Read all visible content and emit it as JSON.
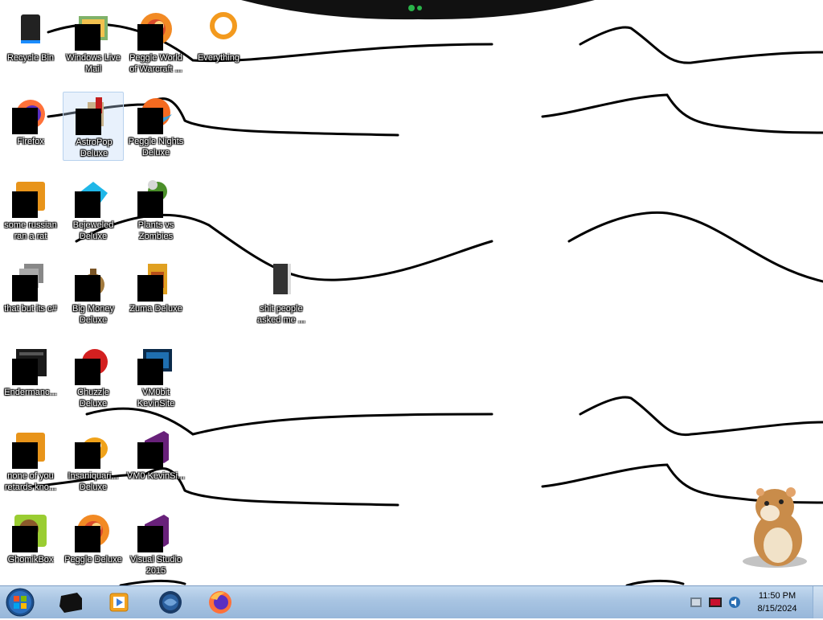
{
  "desktop": {
    "icons": [
      {
        "label": "Recycle Bin",
        "icon": "recycle-bin-icon"
      },
      {
        "label": "Windows Live Mail",
        "icon": "mail-icon"
      },
      {
        "label": "Peggle World of Warcraft ...",
        "icon": "peggle-icon"
      },
      {
        "label": "Everything",
        "icon": "search-app-icon"
      },
      {
        "label": "Firefox",
        "icon": "firefox-icon"
      },
      {
        "label": "AstroPop Deluxe",
        "icon": "astropop-icon"
      },
      {
        "label": "Peggle Nights Deluxe",
        "icon": "peggle-nights-icon"
      },
      {
        "label": "some russian ran a rat",
        "icon": "app-icon"
      },
      {
        "label": "Bejeweled Deluxe",
        "icon": "gem-icon"
      },
      {
        "label": "Plants vs Zombies",
        "icon": "plant-icon"
      },
      {
        "label": "that but its c#",
        "icon": "shortcut-icon"
      },
      {
        "label": "Big Money Deluxe",
        "icon": "money-bag-icon"
      },
      {
        "label": "Zuma Deluxe",
        "icon": "zuma-icon"
      },
      {
        "label": "shit people asked me ...",
        "icon": "folder-icon"
      },
      {
        "label": "Endermanc...",
        "icon": "terminal-icon"
      },
      {
        "label": "Chuzzle Deluxe",
        "icon": "chuzzle-icon"
      },
      {
        "label": "VM0bit KevinSite",
        "icon": "monitor-icon"
      },
      {
        "label": "none of you retards kno...",
        "icon": "app-icon"
      },
      {
        "label": "Insaniquari... Deluxe",
        "icon": "fish-icon"
      },
      {
        "label": "VM0 KevinSi...",
        "icon": "visual-studio-icon"
      },
      {
        "label": "GhomikBox",
        "icon": "box-icon"
      },
      {
        "label": "Peggle Deluxe",
        "icon": "peggle-icon"
      },
      {
        "label": "Visual Studio 2015",
        "icon": "visual-studio-icon"
      }
    ]
  },
  "taskbar": {
    "start_label": "Start",
    "pinned": [
      {
        "name": "taskbar-app-dark",
        "icon": "app-icon"
      },
      {
        "name": "taskbar-app-media",
        "icon": "media-player-icon"
      },
      {
        "name": "taskbar-app-globe",
        "icon": "globe-icon"
      },
      {
        "name": "taskbar-app-firefox",
        "icon": "firefox-icon"
      }
    ],
    "tray": {
      "time": "11:50 PM",
      "date": "8/15/2024"
    }
  },
  "colors": {
    "taskbar": "#a8c4e2",
    "label_text": "#ffffff",
    "redaction": "#000000"
  }
}
